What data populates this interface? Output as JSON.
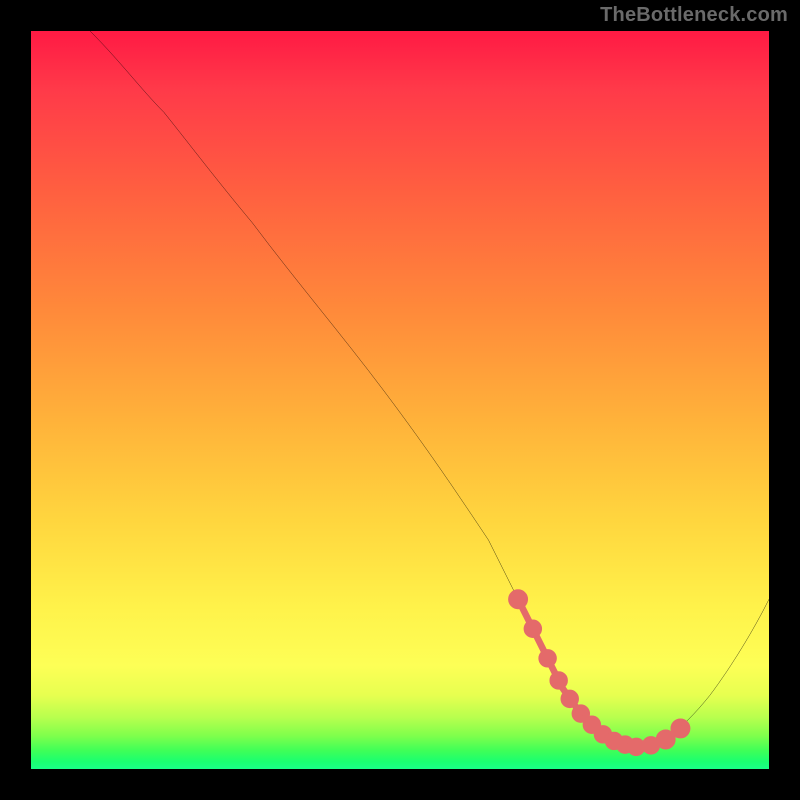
{
  "watermark": "TheBottleneck.com",
  "chart_data": {
    "type": "line",
    "title": "",
    "xlabel": "",
    "ylabel": "",
    "xlim": [
      0,
      100
    ],
    "ylim": [
      0,
      100
    ],
    "grid": false,
    "legend": false,
    "background_gradient": {
      "stops": [
        {
          "pos": 0,
          "color": "#ff1a44",
          "meaning": "high-bottleneck"
        },
        {
          "pos": 0.6,
          "color": "#ffc040"
        },
        {
          "pos": 0.85,
          "color": "#fff24a"
        },
        {
          "pos": 0.97,
          "color": "#3fff58",
          "meaning": "optimal"
        },
        {
          "pos": 1.0,
          "color": "#1aff88"
        }
      ]
    },
    "series": [
      {
        "name": "bottleneck-curve",
        "color": "#000000",
        "width": 2,
        "x": [
          8,
          12,
          18,
          26,
          34,
          42,
          50,
          58,
          63,
          66,
          68,
          71,
          74,
          77,
          80,
          83,
          85,
          88,
          92,
          96,
          100
        ],
        "y": [
          100,
          96,
          89,
          79,
          69,
          59,
          49,
          38,
          30,
          24,
          19,
          13,
          9,
          6,
          4,
          3,
          3,
          5,
          9,
          15,
          23
        ]
      },
      {
        "name": "optimal-band-markers",
        "color": "#e46a6a",
        "type": "scatter",
        "marker_size": 5,
        "x": [
          66,
          68,
          70,
          71,
          73,
          74,
          76,
          77,
          79,
          80,
          82,
          84,
          86,
          88
        ],
        "y": [
          23,
          18,
          14,
          12,
          9,
          8,
          6,
          5,
          4,
          4,
          3,
          3,
          4,
          6
        ]
      }
    ]
  },
  "colors": {
    "frame": "#000000",
    "watermark": "#6a6a6a",
    "curve": "#000000",
    "markers": "#e46a6a"
  }
}
